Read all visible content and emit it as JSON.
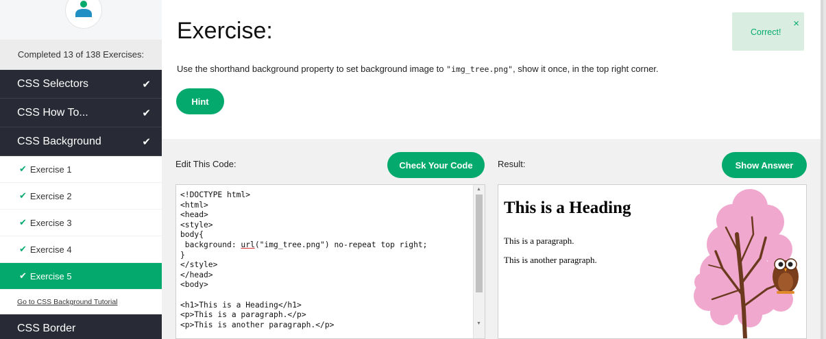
{
  "sidebar": {
    "progress": "Completed 13 of 138 Exercises:",
    "sections_top": [
      {
        "label": "CSS Selectors",
        "done": true
      },
      {
        "label": "CSS How To...",
        "done": true
      },
      {
        "label": "CSS Background",
        "done": true
      }
    ],
    "exercises": [
      {
        "label": "Exercise 1"
      },
      {
        "label": "Exercise 2"
      },
      {
        "label": "Exercise 3"
      },
      {
        "label": "Exercise 4"
      },
      {
        "label": "Exercise 5",
        "active": true
      }
    ],
    "tutorial_link": "Go to CSS Background Tutorial",
    "next_section": "CSS Border",
    "check_glyph": "✔"
  },
  "exercise": {
    "title": "Exercise:",
    "instruction_before": "Use the shorthand background property to set background image to ",
    "instruction_code": "\"img_tree.png\"",
    "instruction_after": ", show it once, in the top right corner.",
    "hint_label": "Hint"
  },
  "toast": {
    "message": "Correct!",
    "close_glyph": "×"
  },
  "editor": {
    "label": "Edit This Code:",
    "check_button": "Check Your Code",
    "code_lines": [
      "<!DOCTYPE html>",
      "<html>",
      "<head>",
      "<style>",
      "body{",
      " background: url(\"img_tree.png\") no-repeat top right;",
      "}",
      "</style>",
      "</head>",
      "<body>",
      "",
      "<h1>This is a Heading</h1>",
      "<p>This is a paragraph.</p>",
      "<p>This is another paragraph.</p>"
    ]
  },
  "result": {
    "label": "Result:",
    "show_answer_button": "Show Answer",
    "heading": "This is a Heading",
    "paragraph1": "This is a paragraph.",
    "paragraph2": "This is another paragraph."
  },
  "colors": {
    "accent": "#04aa6d",
    "sidebar_dark": "#282a35",
    "toast_bg": "#d9eee1"
  }
}
